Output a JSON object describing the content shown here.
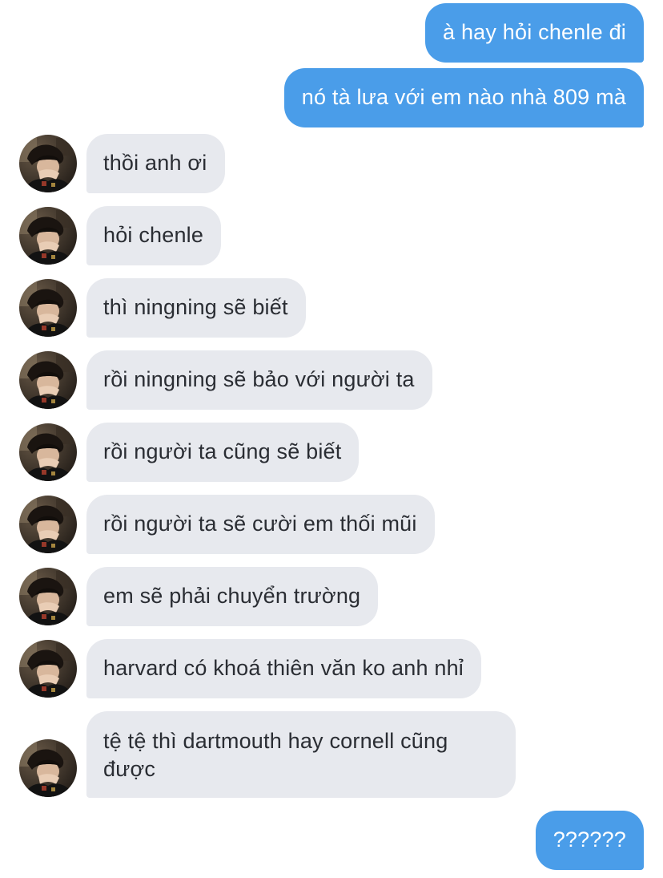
{
  "conversation": {
    "sent_top": [
      {
        "text": "à hay hỏi chenle đi"
      },
      {
        "text": "nó tà lưa với em nào nhà 809 mà"
      }
    ],
    "received": [
      {
        "text": "thồi anh ơi"
      },
      {
        "text": "hỏi chenle"
      },
      {
        "text": "thì ningning sẽ biết"
      },
      {
        "text": "rồi ningning sẽ bảo với người ta"
      },
      {
        "text": "rồi người ta cũng sẽ biết"
      },
      {
        "text": "rồi người ta sẽ cười em thối mũi"
      },
      {
        "text": "em sẽ phải chuyển trường"
      },
      {
        "text": "harvard có khoá thiên văn ko anh nhỉ"
      },
      {
        "text": "tệ tệ thì dartmouth hay cornell cũng được"
      }
    ],
    "sent_bottom": [
      {
        "text": "??????"
      }
    ]
  },
  "colors": {
    "sent_bubble": "#4a9de9",
    "received_bubble": "#e7e9ee",
    "received_text": "#2a2d33"
  },
  "icons": {
    "avatar": "contact-avatar-photo"
  }
}
